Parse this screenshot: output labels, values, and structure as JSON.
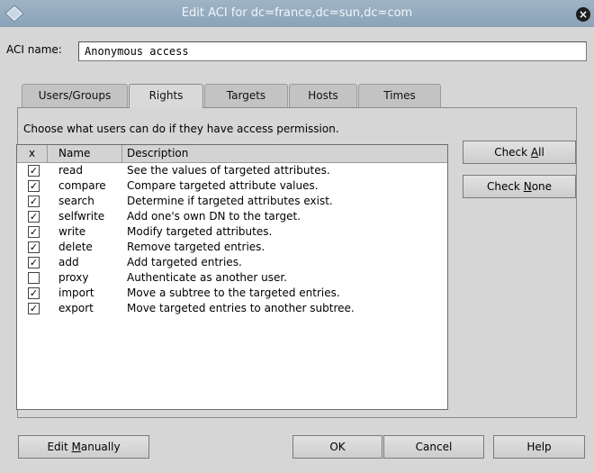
{
  "window": {
    "title": "Edit ACI for dc=france,dc=sun,dc=com",
    "close_glyph": "×",
    "menu_icon": "diamond-icon",
    "accent_color": "#8fa7bc"
  },
  "aci": {
    "label": "ACI name:",
    "value": "Anonymous access"
  },
  "tabs": [
    {
      "label": "Users/Groups",
      "active": false
    },
    {
      "label": "Rights",
      "active": true
    },
    {
      "label": "Targets",
      "active": false
    },
    {
      "label": "Hosts",
      "active": false
    },
    {
      "label": "Times",
      "active": false
    }
  ],
  "rights": {
    "instruction": "Choose what users can do if they have access permission.",
    "columns": [
      "x",
      "Name",
      "Description"
    ],
    "rows": [
      {
        "checked": true,
        "name": "read",
        "description": "See the values of targeted attributes."
      },
      {
        "checked": true,
        "name": "compare",
        "description": "Compare targeted attribute values."
      },
      {
        "checked": true,
        "name": "search",
        "description": "Determine if targeted attributes exist."
      },
      {
        "checked": true,
        "name": "selfwrite",
        "description": "Add one's own DN to the target."
      },
      {
        "checked": true,
        "name": "write",
        "description": "Modify targeted attributes."
      },
      {
        "checked": true,
        "name": "delete",
        "description": "Remove targeted entries."
      },
      {
        "checked": true,
        "name": "add",
        "description": "Add targeted entries."
      },
      {
        "checked": false,
        "name": "proxy",
        "description": "Authenticate as another user."
      },
      {
        "checked": true,
        "name": "import",
        "description": "Move a subtree to the targeted entries."
      },
      {
        "checked": true,
        "name": "export",
        "description": "Move targeted entries to another subtree."
      }
    ],
    "check_all_label": "Check All",
    "check_none_label": "Check None"
  },
  "footer": {
    "edit_manually_label": "Edit Manually",
    "ok_label": "OK",
    "cancel_label": "Cancel",
    "help_label": "Help"
  }
}
